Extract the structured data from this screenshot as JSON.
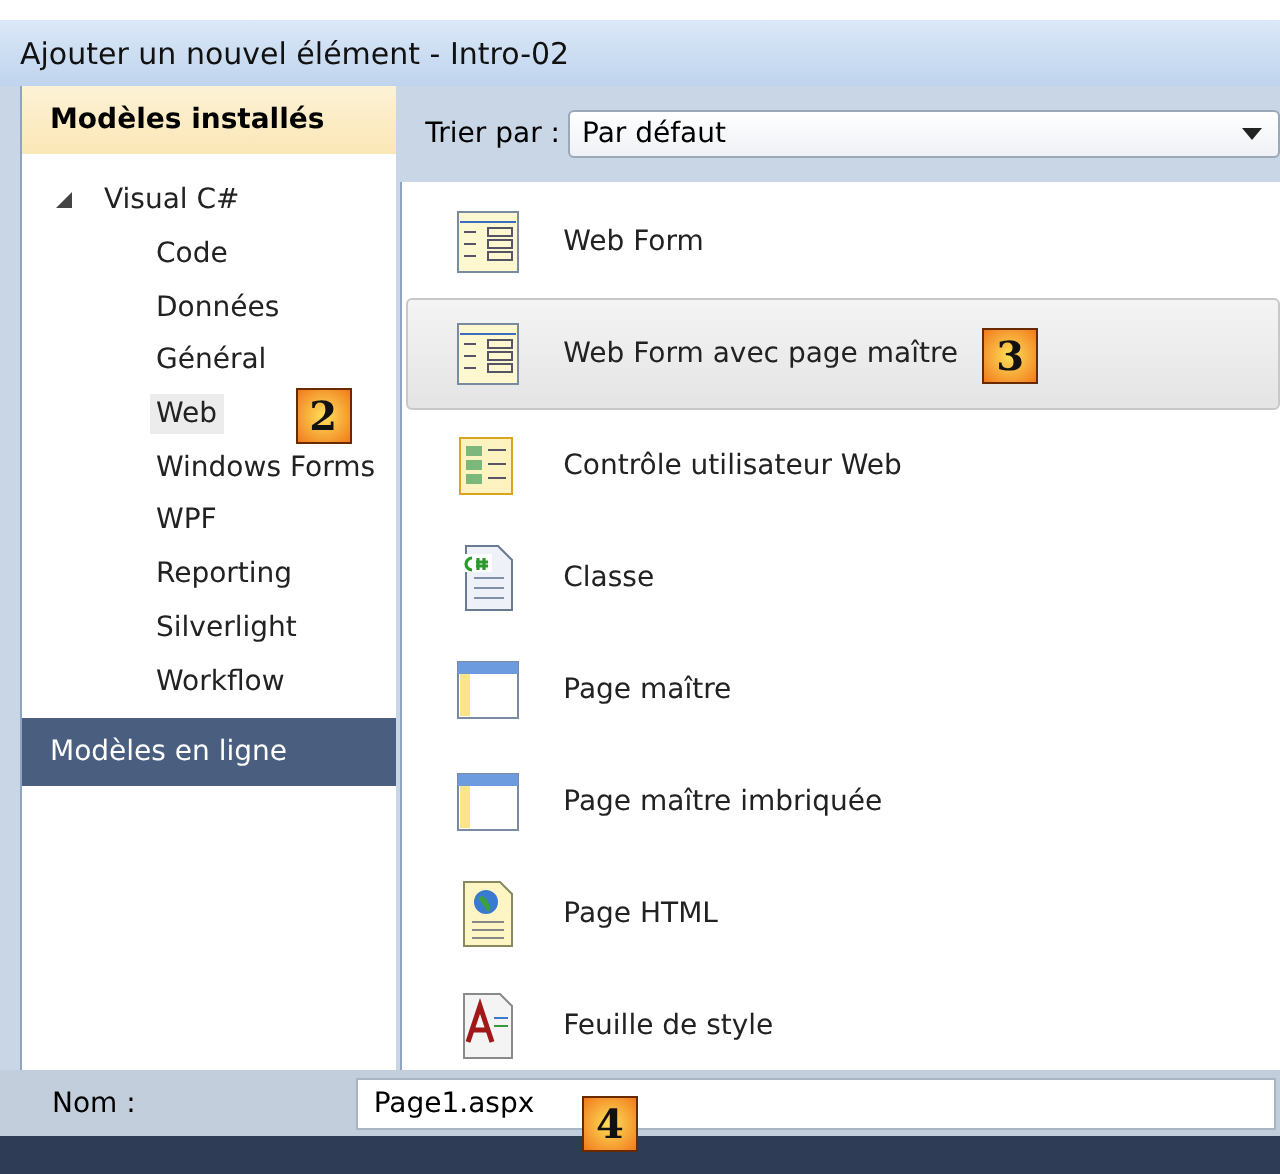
{
  "window": {
    "title": "Ajouter un nouvel élément - Intro-02"
  },
  "sidebar": {
    "header": "Modèles installés",
    "tree": [
      {
        "label": "Visual C#",
        "expanded": true,
        "selected": false,
        "children": [
          {
            "label": "Code",
            "selected": false
          },
          {
            "label": "Données",
            "selected": false
          },
          {
            "label": "Général",
            "selected": false
          },
          {
            "label": "Web",
            "selected": true,
            "callout": "2"
          },
          {
            "label": "Windows Forms",
            "selected": false
          },
          {
            "label": "WPF",
            "selected": false
          },
          {
            "label": "Reporting",
            "selected": false
          },
          {
            "label": "Silverlight",
            "selected": false
          },
          {
            "label": "Workflow",
            "selected": false
          }
        ]
      }
    ],
    "online_section": "Modèles en ligne"
  },
  "sort": {
    "label": "Trier par :",
    "value": "Par défaut"
  },
  "templates": [
    {
      "label": "Web Form",
      "kind": "form",
      "selected": false
    },
    {
      "label": "Web Form avec page maître",
      "kind": "form",
      "selected": true,
      "callout": "3"
    },
    {
      "label": "Contrôle utilisateur Web",
      "kind": "control",
      "selected": false
    },
    {
      "label": "Classe",
      "kind": "class",
      "selected": false
    },
    {
      "label": "Page maître",
      "kind": "master",
      "selected": false
    },
    {
      "label": "Page maître imbriquée",
      "kind": "master",
      "selected": false
    },
    {
      "label": "Page HTML",
      "kind": "html",
      "selected": false
    },
    {
      "label": "Feuille de style",
      "kind": "css",
      "selected": false
    }
  ],
  "name_field": {
    "label": "Nom :",
    "value": "Page1.aspx",
    "callout": "4"
  }
}
